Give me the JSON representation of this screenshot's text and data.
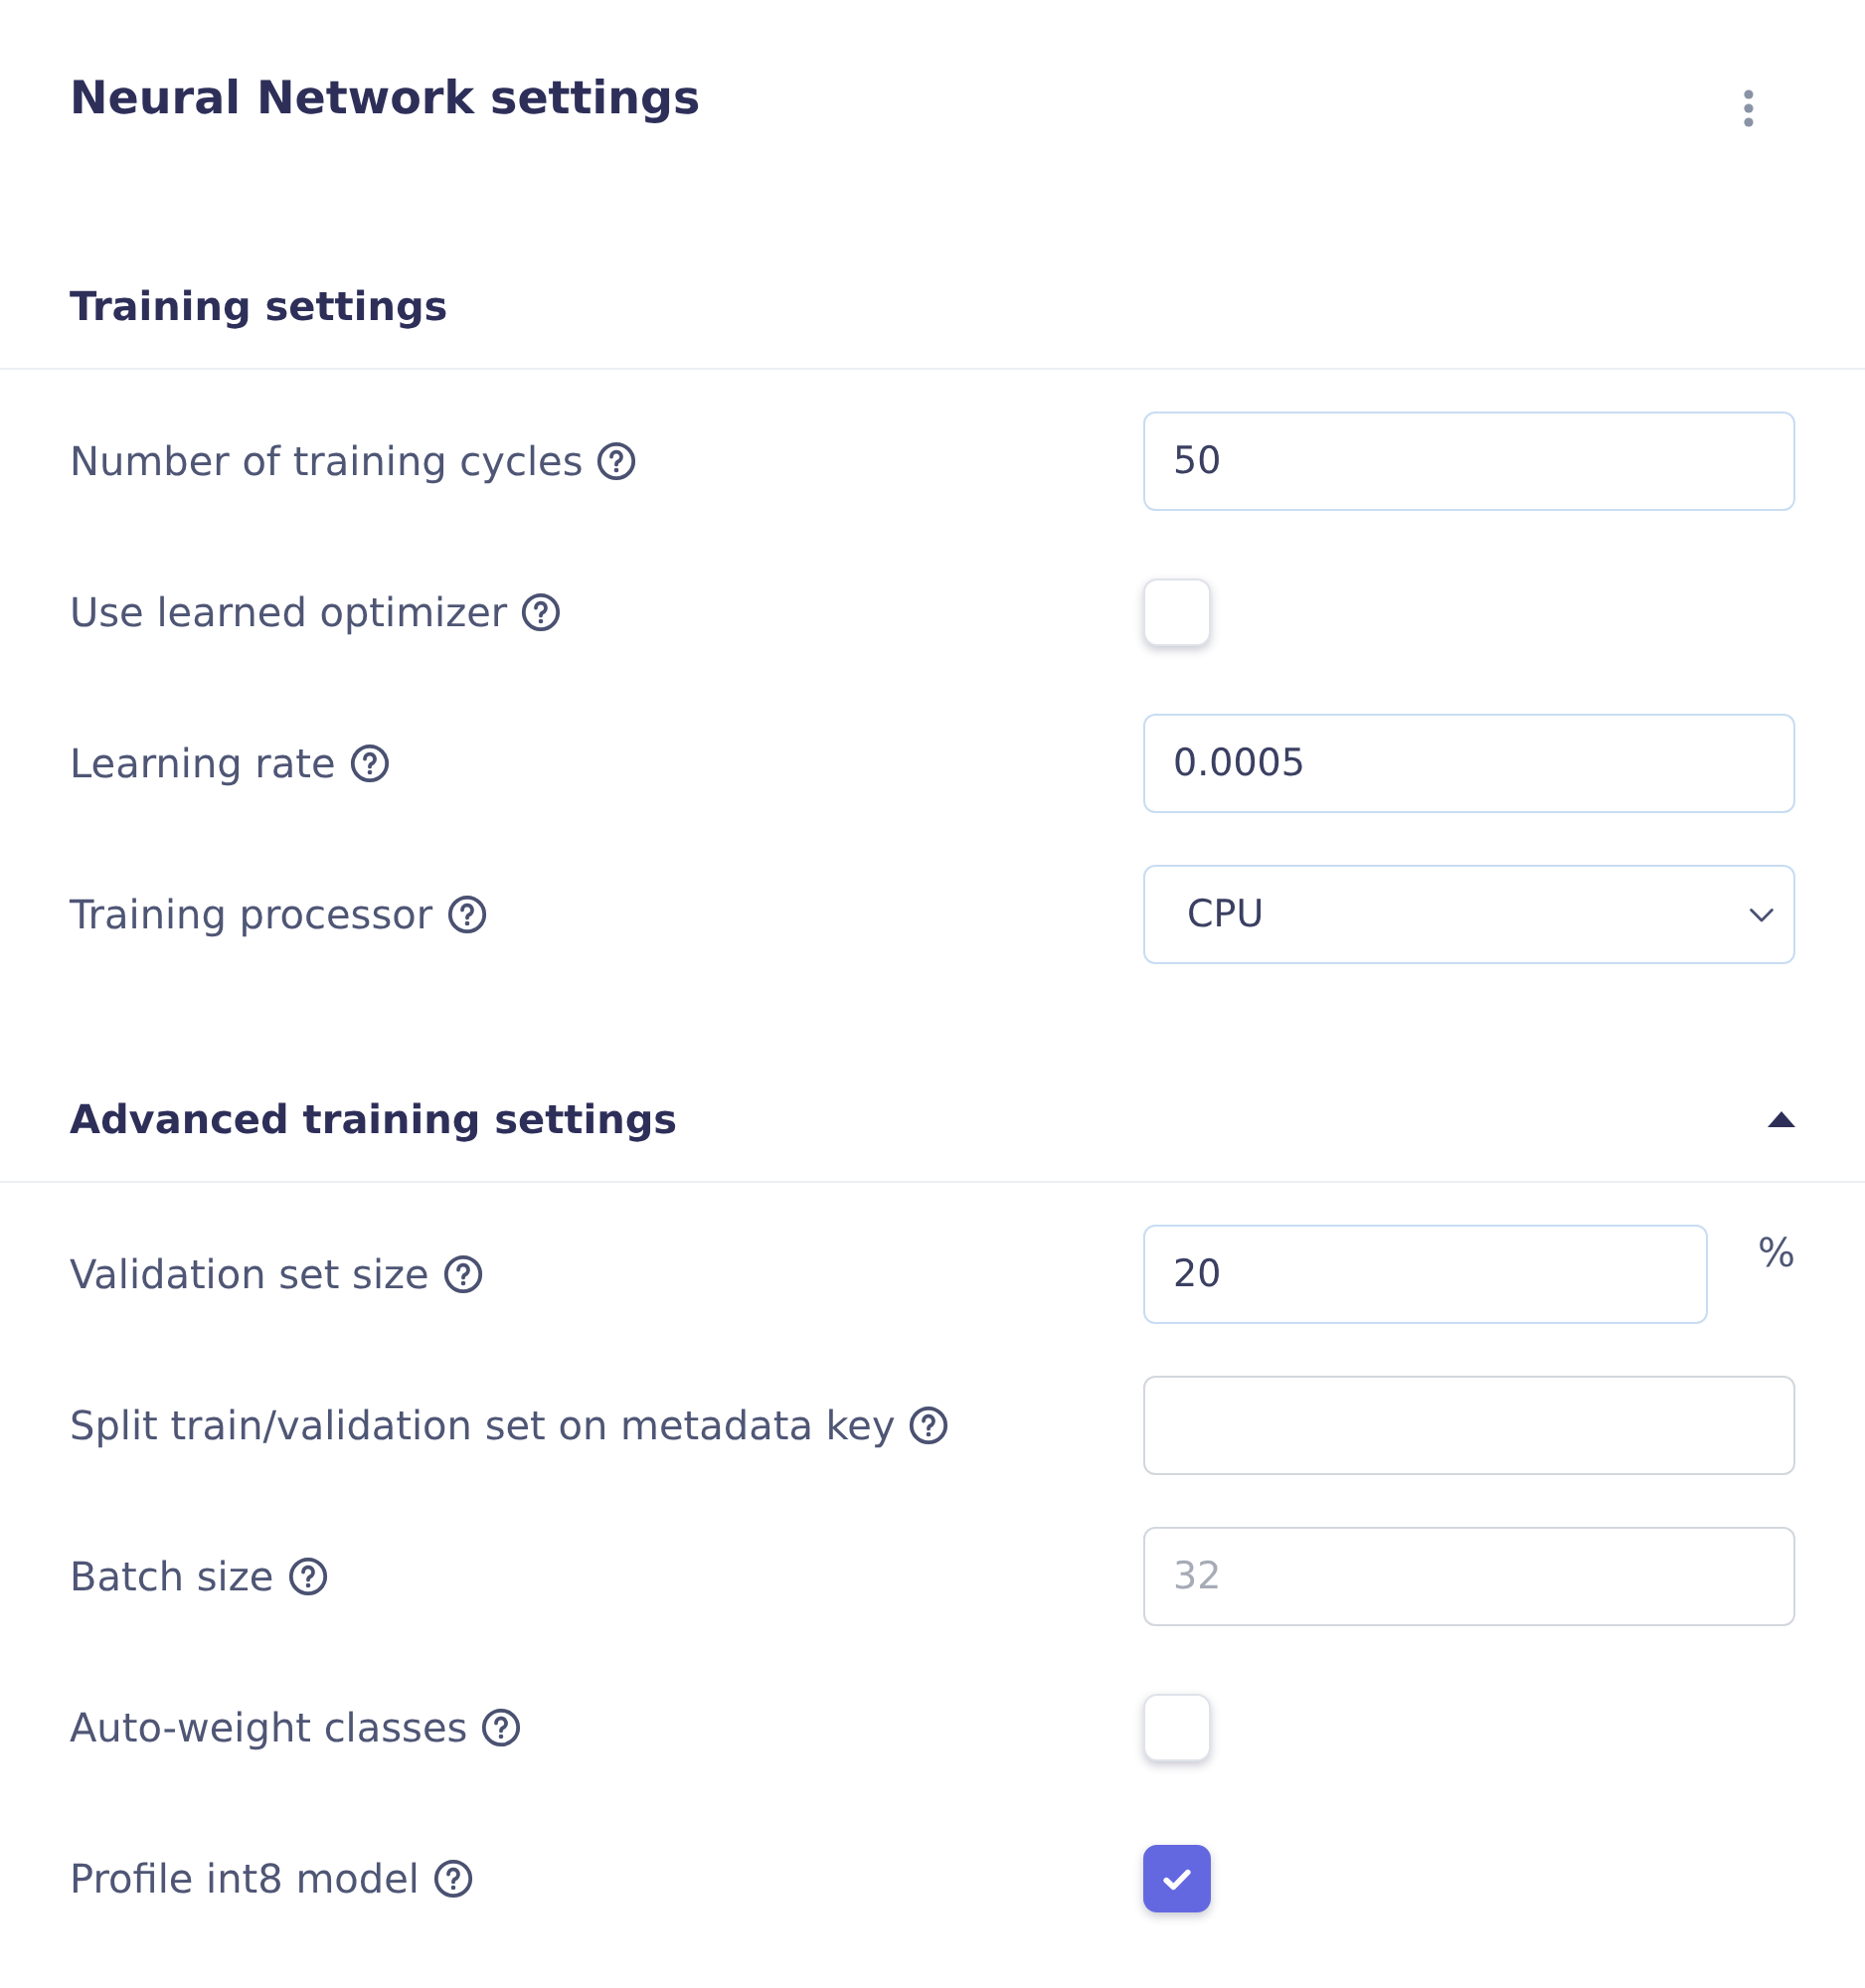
{
  "panel": {
    "title": "Neural Network settings"
  },
  "training_settings": {
    "title": "Training settings",
    "fields": [
      {
        "kind": "input",
        "label": "Number of training cycles",
        "value": "50"
      },
      {
        "kind": "checkbox",
        "label": "Use learned optimizer",
        "checked": false
      },
      {
        "kind": "input",
        "label": "Learning rate",
        "value": "0.0005"
      },
      {
        "kind": "select",
        "label": "Training processor",
        "value": "CPU"
      }
    ]
  },
  "advanced_training_settings": {
    "title": "Advanced training settings",
    "expanded": true,
    "fields": [
      {
        "kind": "input",
        "label": "Validation set size",
        "value": "20",
        "unit": "%"
      },
      {
        "kind": "input",
        "label": "Split train/validation set on metadata key"
      },
      {
        "kind": "input",
        "label": "Batch size",
        "placeholder": "32"
      },
      {
        "kind": "checkbox",
        "label": "Auto-weight classes",
        "checked": false
      },
      {
        "kind": "checkbox",
        "label": "Profile int8 model",
        "checked": true
      }
    ]
  }
}
